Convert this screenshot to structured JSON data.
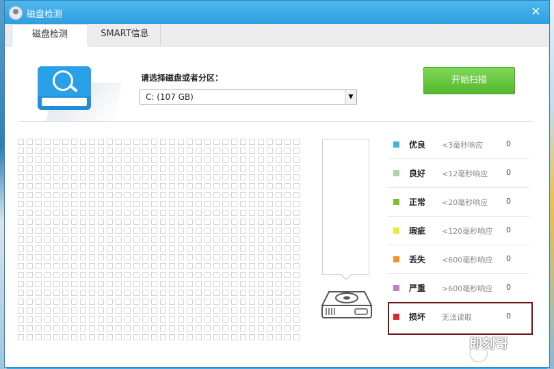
{
  "window": {
    "title": "磁盘检测",
    "close_symbol": "×"
  },
  "tabs": [
    {
      "label": "磁盘检测",
      "active": true
    },
    {
      "label": "SMART信息",
      "active": false
    }
  ],
  "disk_select": {
    "prompt": "请选择磁盘或者分区：",
    "value": "C:  (107 GB)"
  },
  "scan_button": {
    "label": "开始扫描"
  },
  "block_grid": {
    "columns": 32,
    "rows": 23
  },
  "progress": {
    "fraction": 0
  },
  "legend": [
    {
      "label": "优良",
      "desc": "<3毫秒响应",
      "count": "0",
      "color": "#43b7d1"
    },
    {
      "label": "良好",
      "desc": "<12毫秒响应",
      "count": "0",
      "color": "#a9d5a2"
    },
    {
      "label": "正常",
      "desc": "<20毫秒响应",
      "count": "0",
      "color": "#7fbf2a"
    },
    {
      "label": "瑕疵",
      "desc": "<120毫秒响应",
      "count": "0",
      "color": "#e8e83a"
    },
    {
      "label": "丢失",
      "desc": "<600毫秒响应",
      "count": "0",
      "color": "#f0922a"
    },
    {
      "label": "严重",
      "desc": ">600毫秒响应",
      "count": "0",
      "color": "#c47cc6"
    },
    {
      "label": "损坏",
      "desc": "无法读取",
      "count": "0",
      "color": "#d62a2a"
    }
  ],
  "highlight": {
    "color": "#6b1318"
  },
  "watermark": {
    "text": "即刻哥"
  }
}
